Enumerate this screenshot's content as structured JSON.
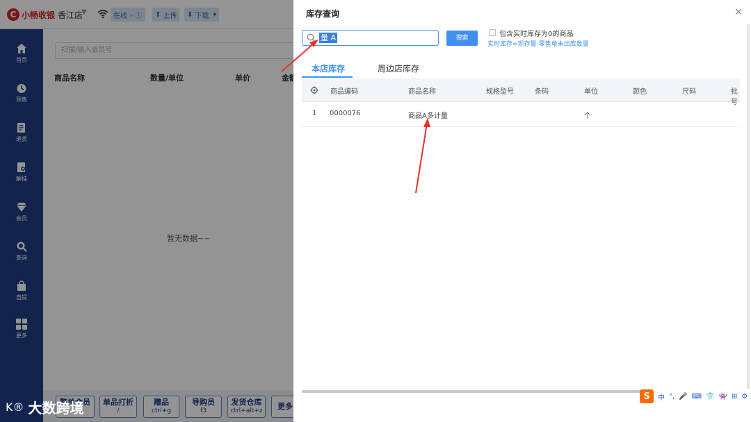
{
  "app": {
    "logo_text": "小畅收银",
    "store_name": "香江店",
    "status_label": "在线",
    "upload_label": "上传",
    "download_label": "下载"
  },
  "sidebar": {
    "items": [
      {
        "label": "首页",
        "icon": "home-icon"
      },
      {
        "label": "预售",
        "icon": "clock-icon"
      },
      {
        "label": "退货",
        "icon": "return-icon"
      },
      {
        "label": "解挂",
        "icon": "unhang-icon"
      },
      {
        "label": "会员",
        "icon": "diamond-icon"
      },
      {
        "label": "查询",
        "icon": "search-icon"
      },
      {
        "label": "自提",
        "icon": "bag-icon"
      },
      {
        "label": "更多",
        "icon": "grid-icon"
      }
    ]
  },
  "main": {
    "member_placeholder": "扫描/输入会员号",
    "columns": [
      "商品名称",
      "数量/单位",
      "单价",
      "金额"
    ],
    "empty_text": "暂无数据~~"
  },
  "bottom_buttons": [
    {
      "label": "整单会员",
      "sub": ""
    },
    {
      "label": "单品打折",
      "sub": "/"
    },
    {
      "label": "赠品",
      "sub": "ctrl+g"
    },
    {
      "label": "导购员",
      "sub": "f3"
    },
    {
      "label": "发货仓库",
      "sub": "ctrl+alt+z"
    },
    {
      "label": "更多",
      "sub": ""
    }
  ],
  "watermark": {
    "mark": "K®",
    "text": "大数跨境"
  },
  "dialog": {
    "title": "库存查询",
    "search_value": "量 A",
    "search_button": "搜索",
    "checkbox_label": "包含实时库存为0的商品",
    "hint": "实时库存=现存量-零售单未出库数量",
    "tabs": [
      "本店库存",
      "周边店库存"
    ],
    "columns": [
      "商品编码",
      "商品名称",
      "规格型号",
      "条码",
      "单位",
      "颜色",
      "尺码",
      "批号"
    ],
    "rows": [
      {
        "index": "1",
        "code": "0000076",
        "name": "商品A多计量",
        "spec": "",
        "barcode": "",
        "unit": "个",
        "color": "",
        "size": "",
        "batch": ""
      }
    ]
  },
  "ime": {
    "logo": "S",
    "items": [
      "中",
      "°,",
      "🎤",
      "⌨",
      "👕",
      "👾",
      "⊞",
      "⚙"
    ]
  }
}
